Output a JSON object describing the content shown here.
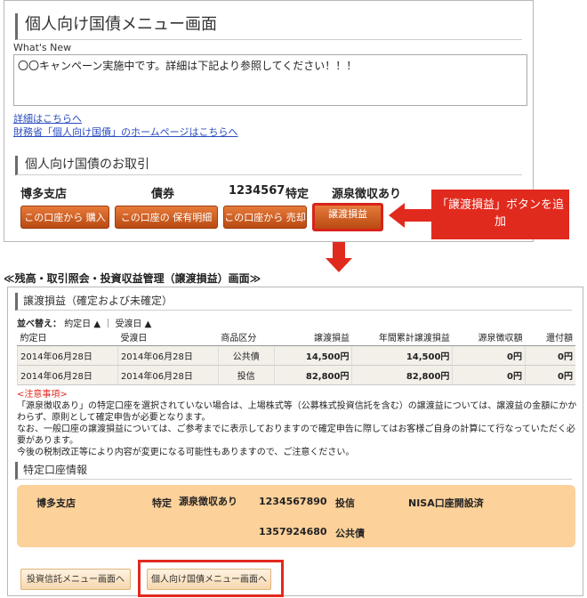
{
  "top": {
    "title": "個人向け国債メニュー画面",
    "whats_new_label": "What's New",
    "news_text": "〇〇キャンペーン実施中です。詳細は下記より参照してください！！！",
    "link_detail": "詳細はこちらへ",
    "link_mof": "財務省「個人向け国債」のホームページはこちらへ",
    "section_title": "個人向け国債のお取引",
    "branch": "博多支店",
    "product": "債券",
    "account_no": "1234567",
    "account_type": "特定",
    "tax_type": "源泉徴収あり",
    "buttons": {
      "buy": "この口座から 購入",
      "holdings": "この口座の 保有明細",
      "sell": "この口座から 売却",
      "gain": "譲渡損益"
    }
  },
  "callout": "「譲渡損益」ボタンを追加",
  "screen_caption": "≪残高・取引照会・投資収益管理（譲渡損益）画面≫",
  "bottom": {
    "title": "譲渡損益（確定および未確定）",
    "sort_label": "並べ替え：",
    "sort_contract": "約定日 ▲",
    "sort_sep": "｜",
    "sort_delivery": "受渡日 ▲",
    "columns": [
      "約定日",
      "受渡日",
      "商品区分",
      "譲渡損益",
      "年間累計譲渡損益",
      "源泉徴収額",
      "還付額"
    ],
    "rows": [
      [
        "2014年06月28日",
        "2014年06月28日",
        "公共債",
        "14,500円",
        "14,500円",
        "0円",
        "0円"
      ],
      [
        "2014年06月28日",
        "2014年06月28日",
        "投信",
        "82,800円",
        "82,800円",
        "0円",
        "0円"
      ]
    ],
    "notice_head": "<注意事項>",
    "notice_1": "「源泉徴収あり」の特定口座を選択されていない場合は、上場株式等（公募株式投資信託を含む）の譲渡益については、譲渡益の金額にかかわらず、原則として確定申告が必要となります。",
    "notice_2": "なお、一般口座の譲渡損益については、ご参考までに表示しておりますので確定申告に際してはお客様ご自身の計算にて行なっていただく必要があります。",
    "notice_3": "今後の税制改正等により内容が変更になる可能性もありますので、ご注意ください。",
    "acct_section": "特定口座情報",
    "acct": {
      "branch": "博多支店",
      "type": "特定",
      "tax": "源泉徴収あり",
      "no1": "1234567890",
      "prod1": "投信",
      "nisa": "NISA口座開設済",
      "no2": "1357924680",
      "prod2": "公共債"
    },
    "btn_trust_menu": "投資信託メニュー画面へ",
    "btn_bond_menu": "個人向け国債メニュー画面へ"
  }
}
